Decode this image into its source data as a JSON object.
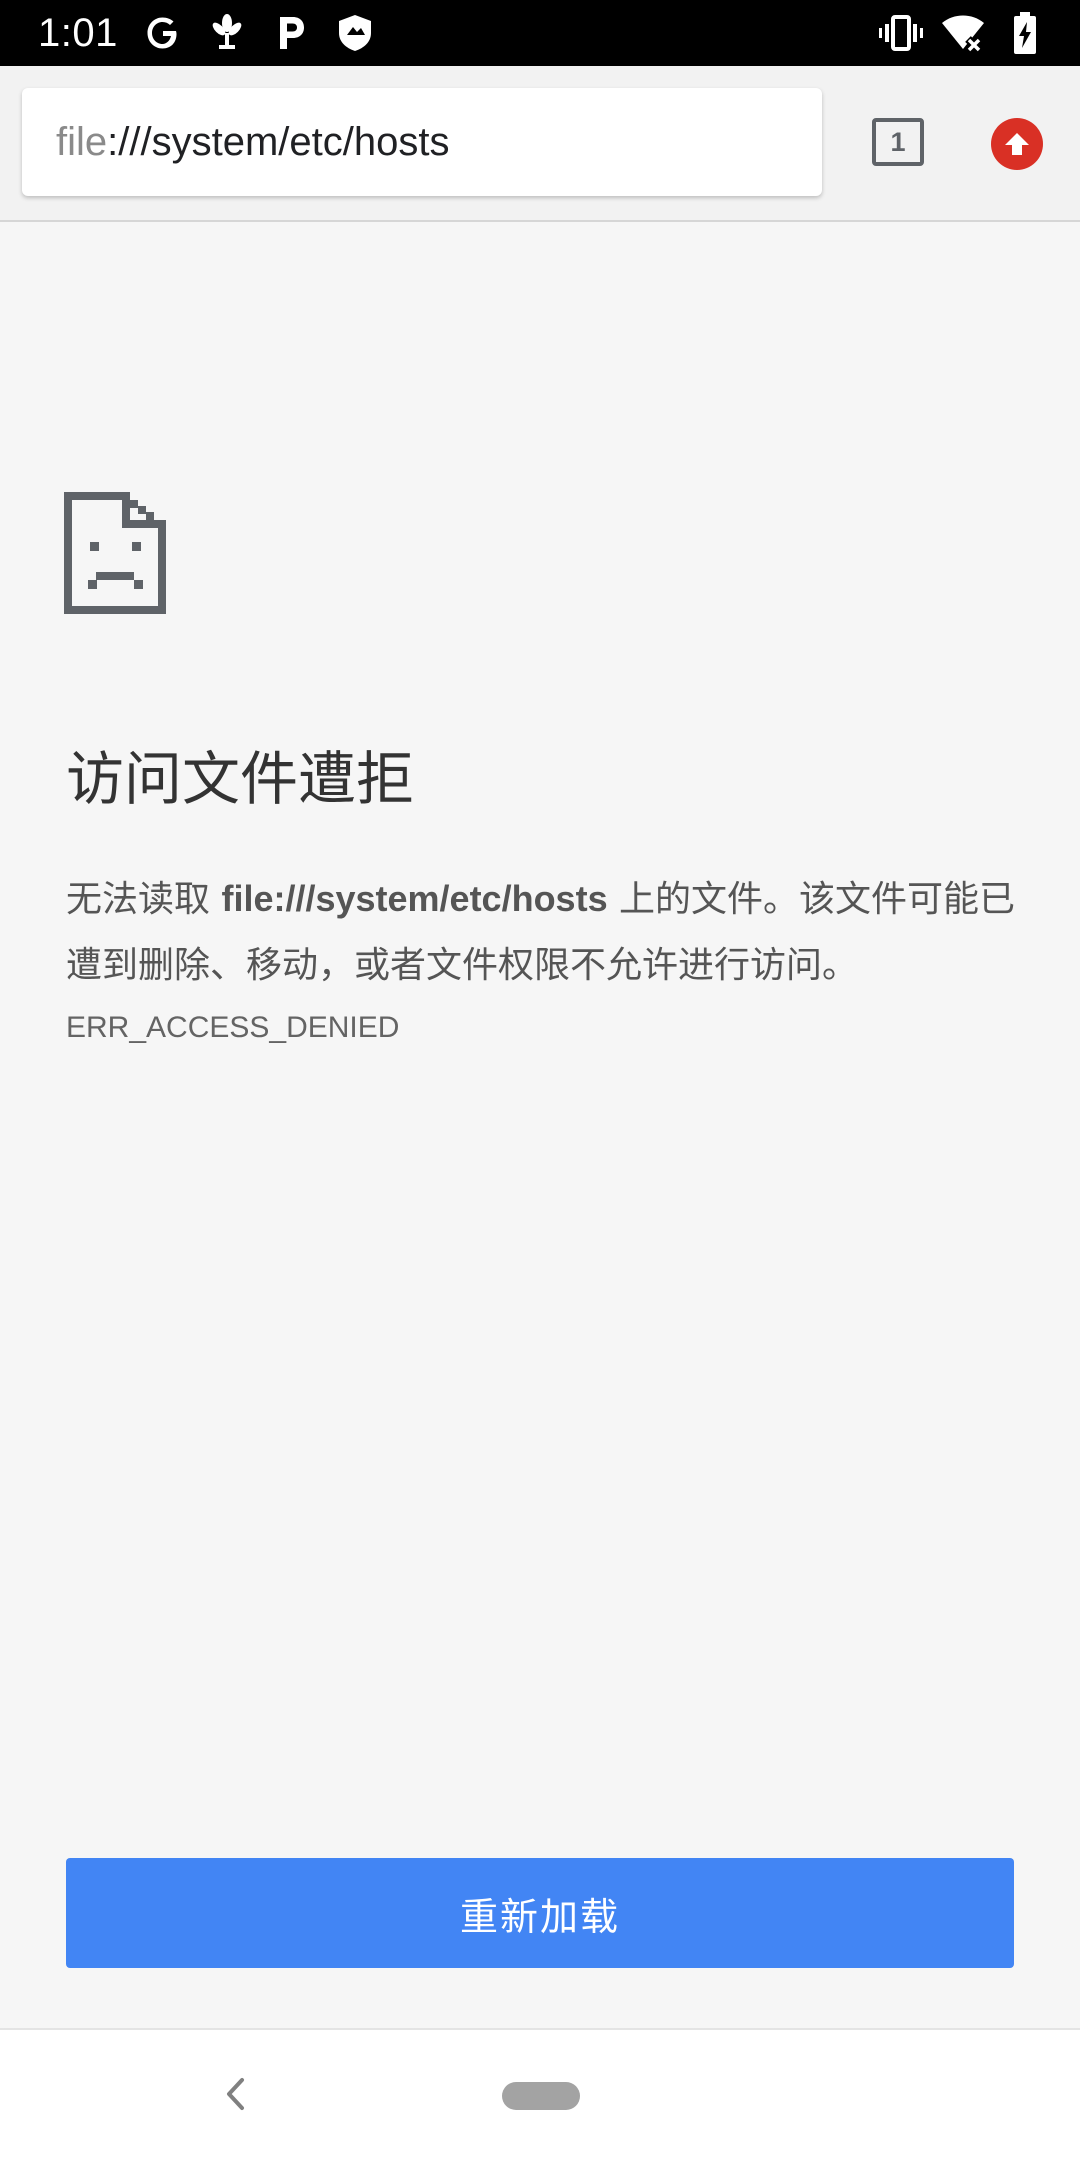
{
  "status_bar": {
    "time": "1:01",
    "left_icons": [
      "google-icon",
      "pinwheel-icon",
      "parking-icon",
      "shield-icon"
    ],
    "right_icons": [
      "vibrate-icon",
      "wifi-off-icon",
      "battery-charging-icon"
    ]
  },
  "toolbar": {
    "url_scheme": "file",
    "url_rest": ":///system/etc/hosts",
    "tab_count": "1",
    "update_icon": "arrow-up-icon",
    "update_color": "#d93025"
  },
  "error": {
    "icon": "sad-file-icon",
    "title": "访问文件遭拒",
    "message_prefix": "无法读取 ",
    "message_url": "file:///system/etc/hosts",
    "message_suffix": " 上的文件。该文件可能已遭到删除、移动，或者文件权限不允许进行访问。",
    "code": "ERR_ACCESS_DENIED"
  },
  "reload_button": {
    "label": "重新加载",
    "color": "#4285f4"
  },
  "nav_bar": {
    "back_icon": "back-chevron-icon",
    "home_icon": "home-pill-icon"
  }
}
